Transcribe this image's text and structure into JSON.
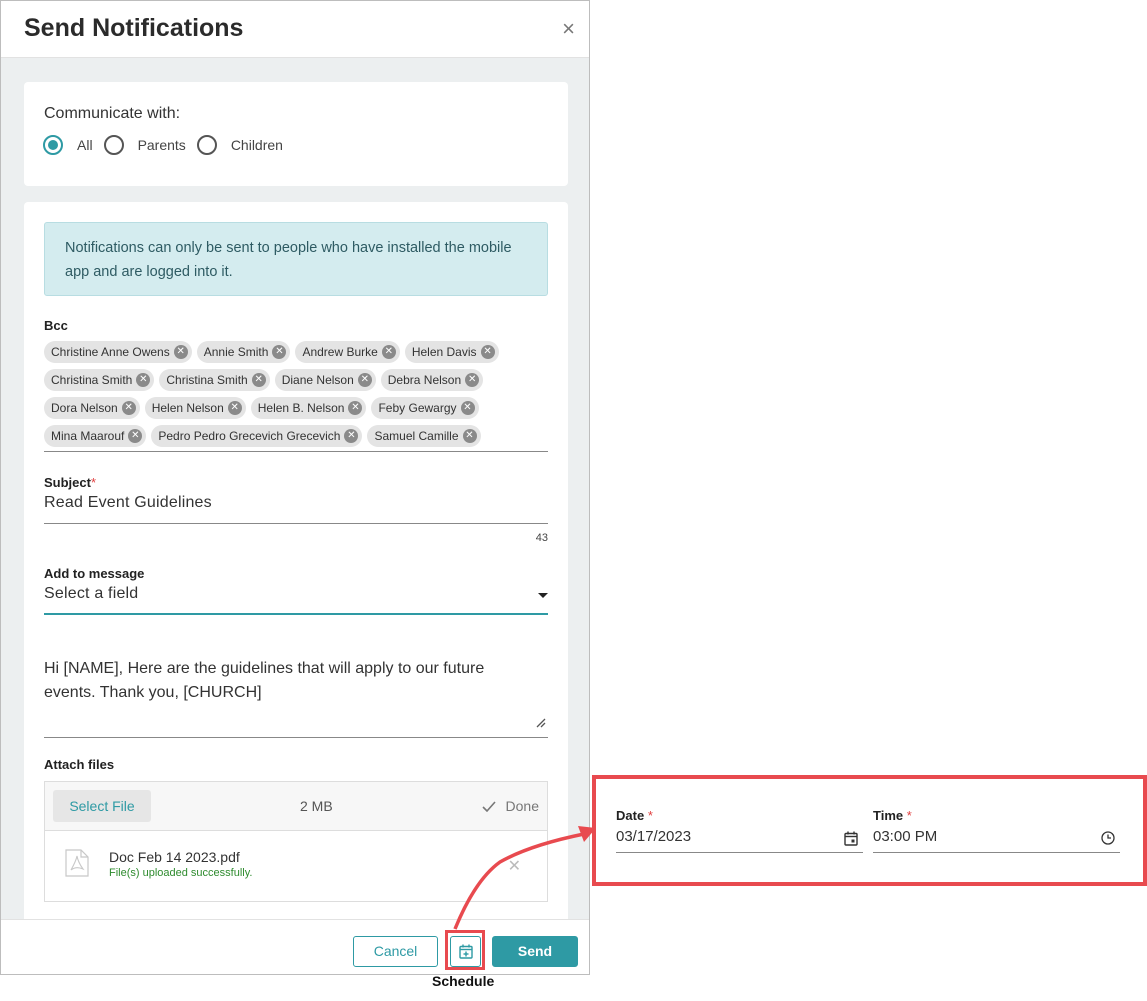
{
  "dialog": {
    "title": "Send Notifications",
    "close_glyph": "×"
  },
  "communicate": {
    "label": "Communicate with:",
    "options": [
      {
        "label": "All",
        "selected": true
      },
      {
        "label": "Parents",
        "selected": false
      },
      {
        "label": "Children",
        "selected": false
      }
    ]
  },
  "info_message": "Notifications can only be sent to people who have installed the mobile app and are logged into it.",
  "bcc": {
    "label": "Bcc",
    "recipients": [
      [
        "Christine Anne Owens",
        "Annie Smith",
        "Andrew Burke",
        "Helen Davis"
      ],
      [
        "Christina Smith",
        "Christina Smith",
        "Diane Nelson",
        "Debra Nelson"
      ],
      [
        "Dora Nelson",
        "Helen Nelson",
        "Helen B. Nelson",
        "Feby Gewargy"
      ],
      [
        "Mina Maarouf",
        "Pedro Pedro Grecevich Grecevich",
        "Samuel Camille"
      ]
    ]
  },
  "subject": {
    "label": "Subject",
    "required_mark": "*",
    "value": "Read Event Guidelines",
    "counter": "43"
  },
  "add_to_message": {
    "label": "Add to message",
    "value": "Select a field"
  },
  "message": "Hi [NAME], Here are the guidelines that will apply to our future events. Thank you, [CHURCH]",
  "attach": {
    "label": "Attach files",
    "select_button": "Select File",
    "size": "2 MB",
    "done": "Done",
    "file_name": "Doc Feb 14 2023.pdf",
    "file_status": "File(s) uploaded successfully."
  },
  "footer": {
    "cancel": "Cancel",
    "send": "Send",
    "schedule_caption": "Schedule"
  },
  "schedule": {
    "date_label": "Date",
    "date_value": "03/17/2023",
    "time_label": "Time",
    "time_value": "03:00 PM",
    "required_mark": "*"
  },
  "colors": {
    "accent": "#2e9aa4",
    "highlight": "#e84a4f",
    "info_bg": "#d4ecef"
  }
}
